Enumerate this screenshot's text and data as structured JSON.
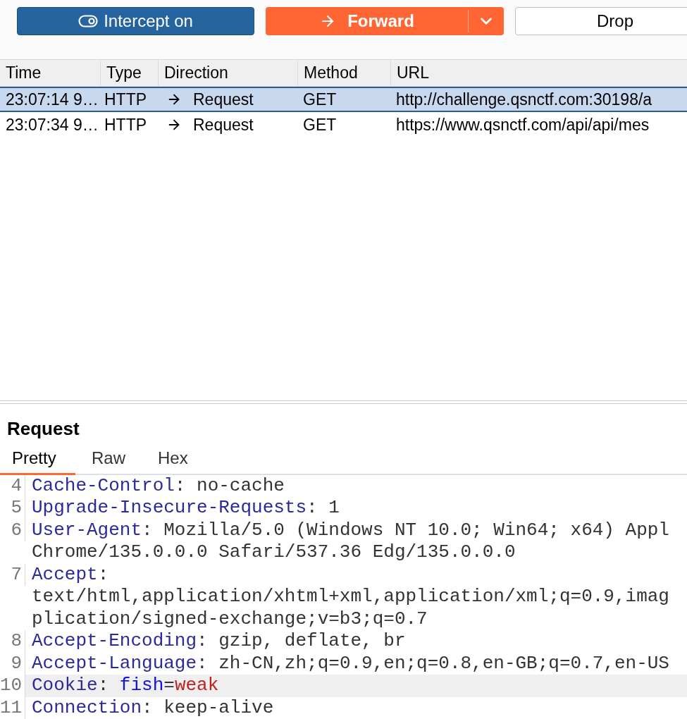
{
  "toolbar": {
    "intercept": {
      "label": "Intercept on",
      "on": true
    },
    "forward": {
      "label": "Forward"
    },
    "drop": {
      "label": "Drop"
    }
  },
  "table": {
    "columns": [
      "Time",
      "Type",
      "Direction",
      "Method",
      "URL"
    ],
    "rows": [
      {
        "time": "23:07:14 9…",
        "type": "HTTP",
        "direction": "Request",
        "method": "GET",
        "url": "http://challenge.qsnctf.com:30198/a",
        "selected": true
      },
      {
        "time": "23:07:34 9…",
        "type": "HTTP",
        "direction": "Request",
        "method": "GET",
        "url": "https://www.qsnctf.com/api/api/mes",
        "selected": false
      }
    ]
  },
  "request": {
    "title": "Request",
    "tabs": [
      {
        "label": "Pretty",
        "selected": true
      },
      {
        "label": "Raw",
        "selected": false
      },
      {
        "label": "Hex",
        "selected": false
      }
    ],
    "lines": [
      {
        "number": "4",
        "selected": false,
        "rows": [
          [
            {
              "kind": "key",
              "text": "Cache-Control"
            },
            {
              "kind": "plain",
              "text": ": no-cache"
            }
          ]
        ]
      },
      {
        "number": "5",
        "selected": false,
        "rows": [
          [
            {
              "kind": "key",
              "text": "Upgrade-Insecure-Requests"
            },
            {
              "kind": "plain",
              "text": ": 1"
            }
          ]
        ]
      },
      {
        "number": "6",
        "selected": false,
        "rows": [
          [
            {
              "kind": "key",
              "text": "User-Agent"
            },
            {
              "kind": "plain",
              "text": ": Mozilla/5.0 (Windows NT 10.0; Win64; x64) Appl"
            }
          ],
          [
            {
              "kind": "plain",
              "text": "Chrome/135.0.0.0 Safari/537.36 Edg/135.0.0.0"
            }
          ]
        ]
      },
      {
        "number": "7",
        "selected": false,
        "rows": [
          [
            {
              "kind": "key",
              "text": "Accept"
            },
            {
              "kind": "plain",
              "text": ":"
            }
          ],
          [
            {
              "kind": "plain",
              "text": "text/html,application/xhtml+xml,application/xml;q=0.9,imag"
            }
          ],
          [
            {
              "kind": "plain",
              "text": "plication/signed-exchange;v=b3;q=0.7"
            }
          ]
        ]
      },
      {
        "number": "8",
        "selected": false,
        "rows": [
          [
            {
              "kind": "key",
              "text": "Accept-Encoding"
            },
            {
              "kind": "plain",
              "text": ": gzip, deflate, br"
            }
          ]
        ]
      },
      {
        "number": "9",
        "selected": false,
        "rows": [
          [
            {
              "kind": "key",
              "text": "Accept-Language"
            },
            {
              "kind": "plain",
              "text": ": zh-CN,zh;q=0.9,en;q=0.8,en-GB;q=0.7,en-US"
            }
          ]
        ]
      },
      {
        "number": "10",
        "selected": true,
        "rows": [
          [
            {
              "kind": "key",
              "text": "Cookie"
            },
            {
              "kind": "plain",
              "text": ": "
            },
            {
              "kind": "param",
              "text": "fish"
            },
            {
              "kind": "plain",
              "text": "="
            },
            {
              "kind": "value",
              "text": "weak"
            }
          ]
        ]
      },
      {
        "number": "11",
        "selected": false,
        "rows": [
          [
            {
              "kind": "key",
              "text": "Connection"
            },
            {
              "kind": "plain",
              "text": ": keep-alive"
            }
          ]
        ]
      }
    ]
  }
}
